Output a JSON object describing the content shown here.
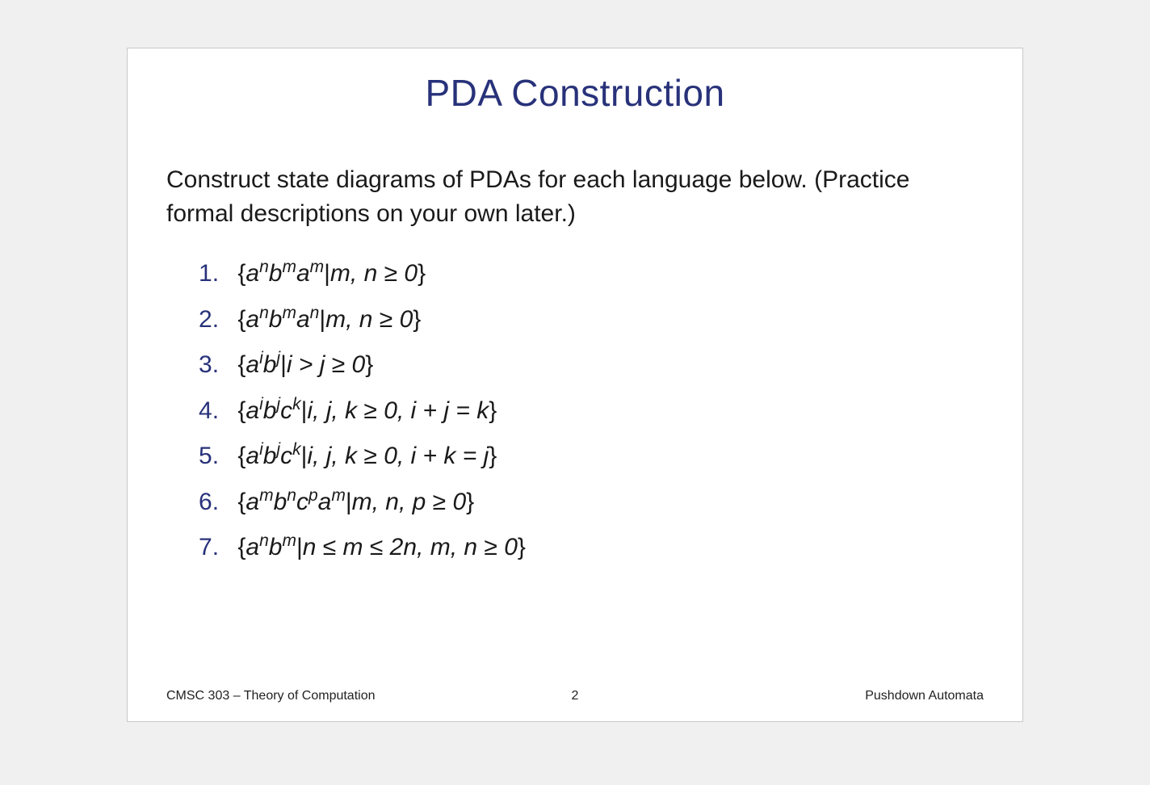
{
  "title": "PDA Construction",
  "instructions": "Construct state diagrams of PDAs for each language below. (Practice formal descriptions on your own later.)",
  "footer": {
    "left": "CMSC 303 – Theory of Computation",
    "center": "2",
    "right": "Pushdown Automata"
  },
  "items": [
    {
      "a1_base": "a",
      "a1_sup": "n",
      "b1_base": "b",
      "b1_sup": "m",
      "c1_base": "a",
      "c1_sup": "m",
      "cond": "m, n ≥ 0"
    },
    {
      "a1_base": "a",
      "a1_sup": "n",
      "b1_base": "b",
      "b1_sup": "m",
      "c1_base": "a",
      "c1_sup": "n",
      "cond": "m, n ≥ 0"
    },
    {
      "a1_base": "a",
      "a1_sup": "i",
      "b1_base": "b",
      "b1_sup": "j",
      "cond": "i > j ≥ 0"
    },
    {
      "a1_base": "a",
      "a1_sup": "i",
      "b1_base": "b",
      "b1_sup": "j",
      "c1_base": "c",
      "c1_sup": "k",
      "cond": "i, j, k ≥ 0, i + j = k"
    },
    {
      "a1_base": "a",
      "a1_sup": "i",
      "b1_base": "b",
      "b1_sup": "j",
      "c1_base": "c",
      "c1_sup": "k",
      "cond": "i, j, k ≥ 0, i + k = j"
    },
    {
      "a1_base": "a",
      "a1_sup": "m",
      "b1_base": "b",
      "b1_sup": "n",
      "c1_base": "c",
      "c1_sup": "p",
      "d1_base": "a",
      "d1_sup": "m",
      "cond": "m, n, p ≥ 0"
    },
    {
      "a1_base": "a",
      "a1_sup": "n",
      "b1_base": "b",
      "b1_sup": "m",
      "cond": "n ≤ m ≤ 2n, m, n ≥ 0"
    }
  ]
}
